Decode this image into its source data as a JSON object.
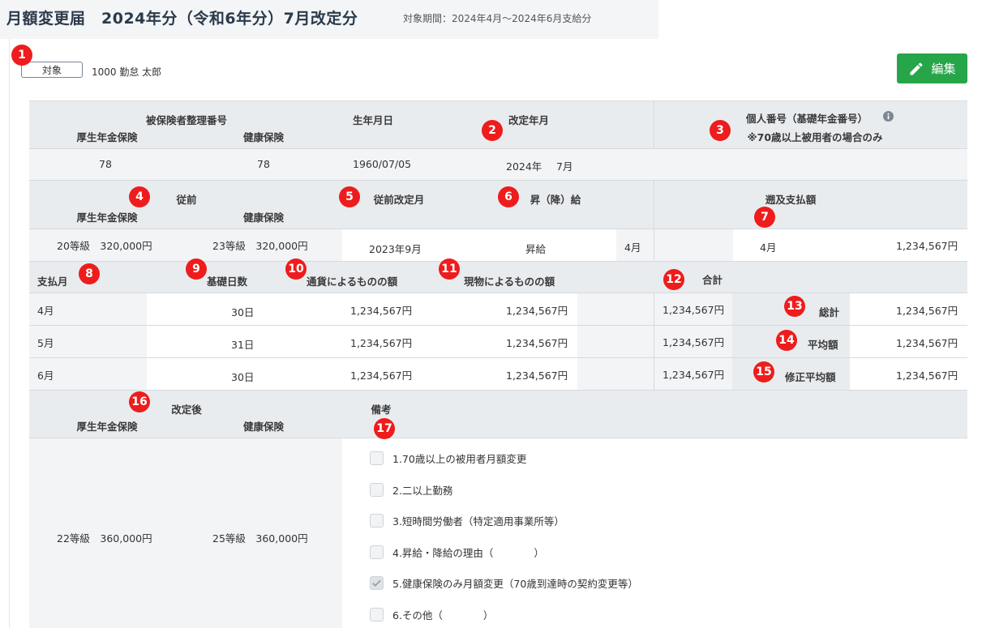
{
  "header": {
    "title": "月額変更届　2024年分（令和6年分）7月改定分",
    "period": "対象期間：2024年4月～2024年6月支給分"
  },
  "target": {
    "label": "対象",
    "employee": "1000  勤怠 太郎"
  },
  "edit_button": {
    "label": "編集"
  },
  "section1": {
    "insured_number_label": "被保険者整理番号",
    "pension_label": "厚生年金保険",
    "health_label": "健康保険",
    "birthdate_label": "生年月日",
    "revision_label": "改定年月",
    "mynumber_label": "個人番号（基礎年金番号）",
    "mynumber_note": "※70歳以上被用者の場合のみ",
    "pension_no": "78",
    "health_no": "78",
    "birthdate": "1960/07/05",
    "revision_year": "2024年",
    "revision_month": "7月"
  },
  "section2": {
    "prev_label": "従前",
    "pension_label": "厚生年金保険",
    "health_label": "健康保険",
    "prev_revision_label": "従前改定月",
    "raise_label": "昇（降）給",
    "retro_label": "遡及支払額",
    "prev_pension": "20等級　320,000円",
    "prev_health": "23等級　320,000円",
    "prev_revision": "2023年9月",
    "raise_type": "昇給",
    "raise_month": "4月",
    "retro_month": "4月",
    "retro_amount": "1,234,567円"
  },
  "pay_table": {
    "headers": {
      "month": "支払月",
      "days": "基礎日数",
      "currency": "通貨によるものの額",
      "kind": "現物によるものの額",
      "total": "合計"
    },
    "rows": [
      {
        "month": "4月",
        "days": "30日",
        "currency": "1,234,567円",
        "kind": "1,234,567円",
        "total": "1,234,567円",
        "sum_label": "総計",
        "sum_value": "1,234,567円"
      },
      {
        "month": "5月",
        "days": "31日",
        "currency": "1,234,567円",
        "kind": "1,234,567円",
        "total": "1,234,567円",
        "sum_label": "平均額",
        "sum_value": "1,234,567円"
      },
      {
        "month": "6月",
        "days": "30日",
        "currency": "1,234,567円",
        "kind": "1,234,567円",
        "total": "1,234,567円",
        "sum_label": "修正平均額",
        "sum_value": "1,234,567円"
      }
    ]
  },
  "section4": {
    "after_label": "改定後",
    "pension_label": "厚生年金保険",
    "health_label": "健康保険",
    "remarks_label": "備考",
    "after_pension": "22等級　360,000円",
    "after_health": "25等級　360,000円"
  },
  "remarks": [
    {
      "label": "1.70歳以上の被用者月額変更",
      "checked": false
    },
    {
      "label": "2.二以上勤務",
      "checked": false
    },
    {
      "label": "3.短時間労働者（特定適用事業所等）",
      "checked": false
    },
    {
      "label": "4.昇給・降給の理由（　　　　）",
      "checked": false
    },
    {
      "label": "5.健康保険のみ月額変更（70歳到達時の契約変更等）",
      "checked": true
    },
    {
      "label": "6.その他（　　　　）",
      "checked": false
    }
  ],
  "badges": [
    "1",
    "2",
    "3",
    "4",
    "5",
    "6",
    "7",
    "8",
    "9",
    "10",
    "11",
    "12",
    "13",
    "14",
    "15",
    "16",
    "17"
  ],
  "colors": {
    "edit_button": "#27a549",
    "badge": "#ee1c1c",
    "header_bg": "#e9ecef"
  }
}
